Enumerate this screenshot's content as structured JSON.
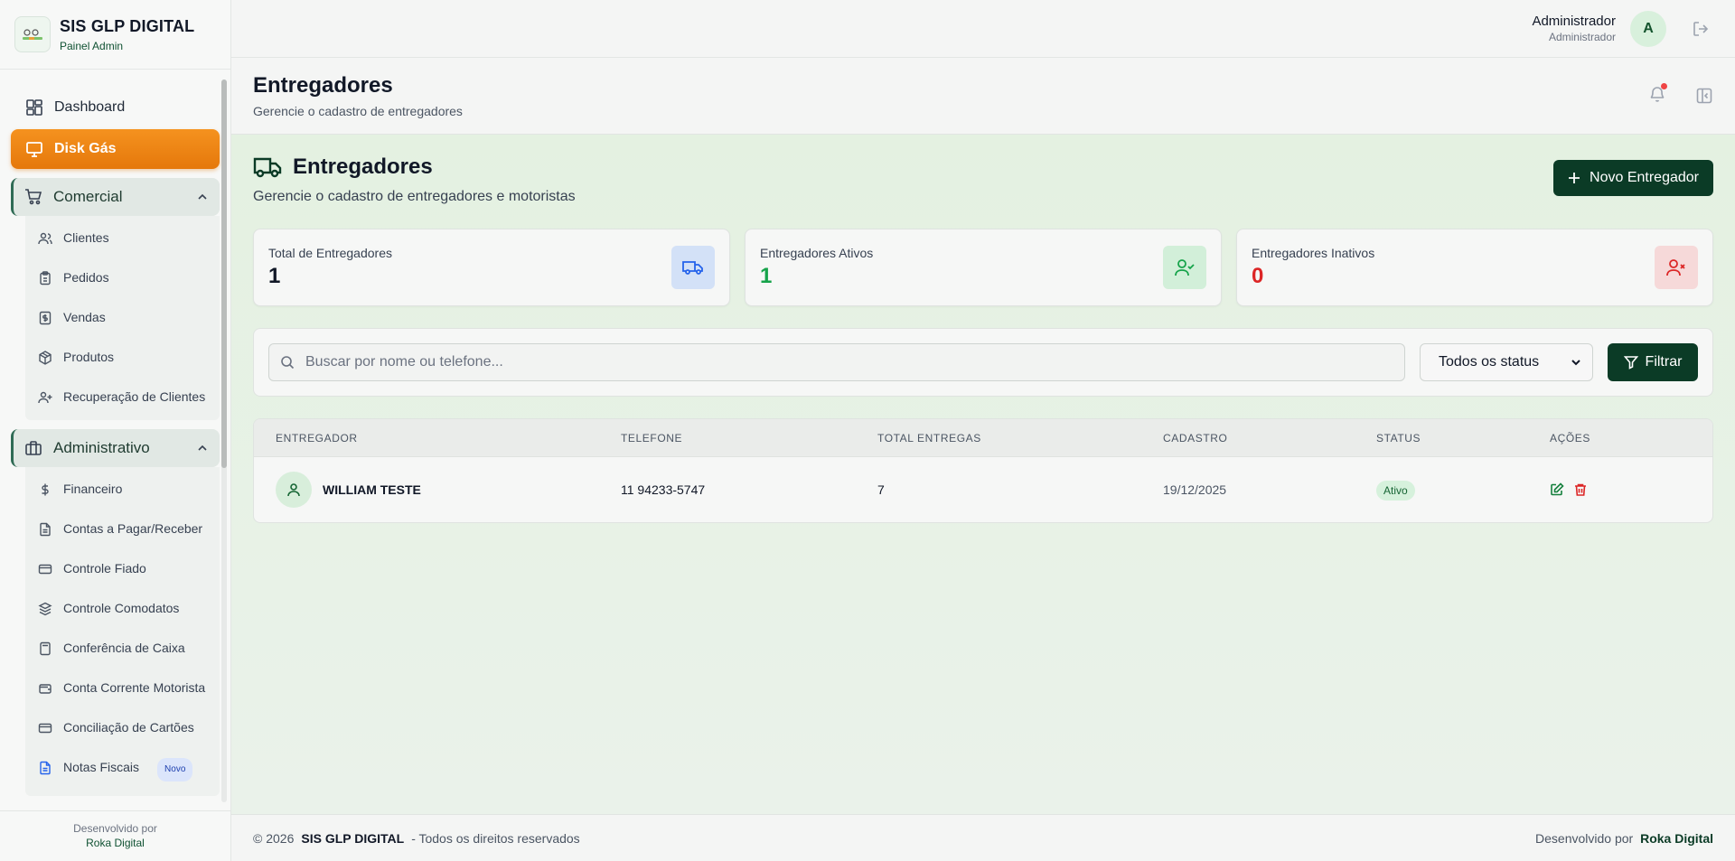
{
  "brand": {
    "title": "SIS GLP DIGITAL",
    "subtitle": "Painel Admin"
  },
  "sidebar": {
    "dashboard": "Dashboard",
    "disk_gas": "Disk Gás",
    "comercial": {
      "label": "Comercial",
      "items": [
        "Clientes",
        "Pedidos",
        "Vendas",
        "Produtos",
        "Recuperação de Clientes"
      ]
    },
    "administrativo": {
      "label": "Administrativo",
      "items": [
        "Financeiro",
        "Contas a Pagar/Receber",
        "Controle Fiado",
        "Controle Comodatos",
        "Conferência de Caixa",
        "Conta Corrente Motorista",
        "Conciliação de Cartões",
        "Notas Fiscais"
      ],
      "new_badge": "Novo"
    },
    "footer": {
      "line1": "Desenvolvido por",
      "line2": "Roka Digital"
    }
  },
  "topbar": {
    "user_name": "Administrador",
    "user_role": "Administrador",
    "avatar_letter": "A"
  },
  "page": {
    "title": "Entregadores",
    "subtitle": "Gerencie o cadastro de entregadores"
  },
  "section": {
    "title": "Entregadores",
    "subtitle": "Gerencie o cadastro de entregadores e motoristas",
    "new_button": "Novo Entregador"
  },
  "stats": [
    {
      "label": "Total de Entregadores",
      "value": "1",
      "color": "#111827"
    },
    {
      "label": "Entregadores Ativos",
      "value": "1",
      "color": "#16a34a"
    },
    {
      "label": "Entregadores Inativos",
      "value": "0",
      "color": "#dc2626"
    }
  ],
  "filters": {
    "search_placeholder": "Buscar por nome ou telefone...",
    "status_selected": "Todos os status",
    "filter_button": "Filtrar"
  },
  "table": {
    "headers": [
      "ENTREGADOR",
      "TELEFONE",
      "TOTAL ENTREGAS",
      "CADASTRO",
      "STATUS",
      "AÇÕES"
    ],
    "rows": [
      {
        "name": "WILLIAM TESTE",
        "phone": "11 94233-5747",
        "total": "7",
        "date": "19/12/2025",
        "status": "Ativo"
      }
    ]
  },
  "footer": {
    "copyright": "© 2026",
    "brand": "SIS GLP DIGITAL",
    "rights": "- Todos os direitos reservados",
    "dev_prefix": "Desenvolvido por",
    "dev_name": "Roka Digital"
  }
}
